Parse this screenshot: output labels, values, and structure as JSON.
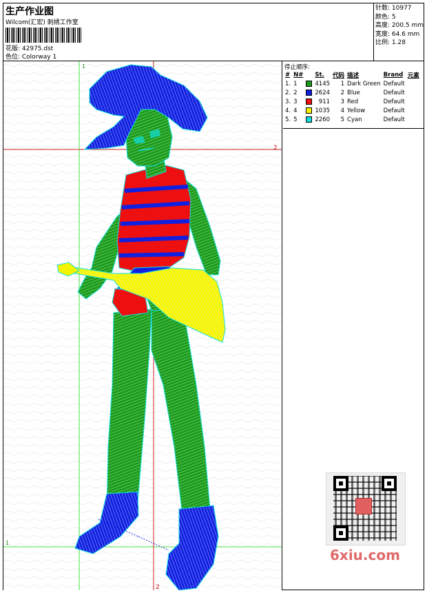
{
  "header": {
    "title": "生产作业图",
    "studio": "Wilcom(汇宏) 刺绣工作室",
    "design_label": "花版: 42975.dst",
    "colorway_label": "色位: Colorway 1"
  },
  "stats": {
    "stitches": "针数: 10977",
    "colors": "颜色: 5",
    "height": "高度: 200.5 mm",
    "width": "宽度: 64.6 mm",
    "scale": "比例: 1.28"
  },
  "guides": {
    "v1_label": "1",
    "v2_label": "2",
    "h1_label": "1",
    "h2_label": "2"
  },
  "legend": {
    "title": "停止顺序:",
    "headers": [
      "#",
      "N#",
      "St.",
      "代码",
      "描述",
      "Brand",
      "元素"
    ],
    "rows": [
      {
        "num": "1.",
        "n": "1",
        "color": "#1a9a1a",
        "st": "4145",
        "code": "1",
        "desc": "Dark Green",
        "brand": "Default",
        "elem": ""
      },
      {
        "num": "2.",
        "n": "2",
        "color": "#1020e0",
        "st": "2624",
        "code": "2",
        "desc": "Blue",
        "brand": "Default",
        "elem": ""
      },
      {
        "num": "3.",
        "n": "3",
        "color": "#ee1010",
        "st": "911",
        "code": "3",
        "desc": "Red",
        "brand": "Default",
        "elem": ""
      },
      {
        "num": "4.",
        "n": "4",
        "color": "#f4f400",
        "st": "1035",
        "code": "4",
        "desc": "Yellow",
        "brand": "Default",
        "elem": ""
      },
      {
        "num": "5.",
        "n": "5",
        "color": "#10e0e0",
        "st": "2260",
        "code": "5",
        "desc": "Cyan",
        "brand": "Default",
        "elem": ""
      }
    ]
  },
  "colors": {
    "green": "#1a9a1a",
    "blue": "#1020e0",
    "red": "#ee1010",
    "yellow": "#f4f400",
    "cyan": "#10e0e0",
    "guide_green": "#40e040",
    "guide_red": "#d02020"
  },
  "watermark": {
    "text": "6xiu.com",
    "qr_icon": "qr-code-icon"
  }
}
